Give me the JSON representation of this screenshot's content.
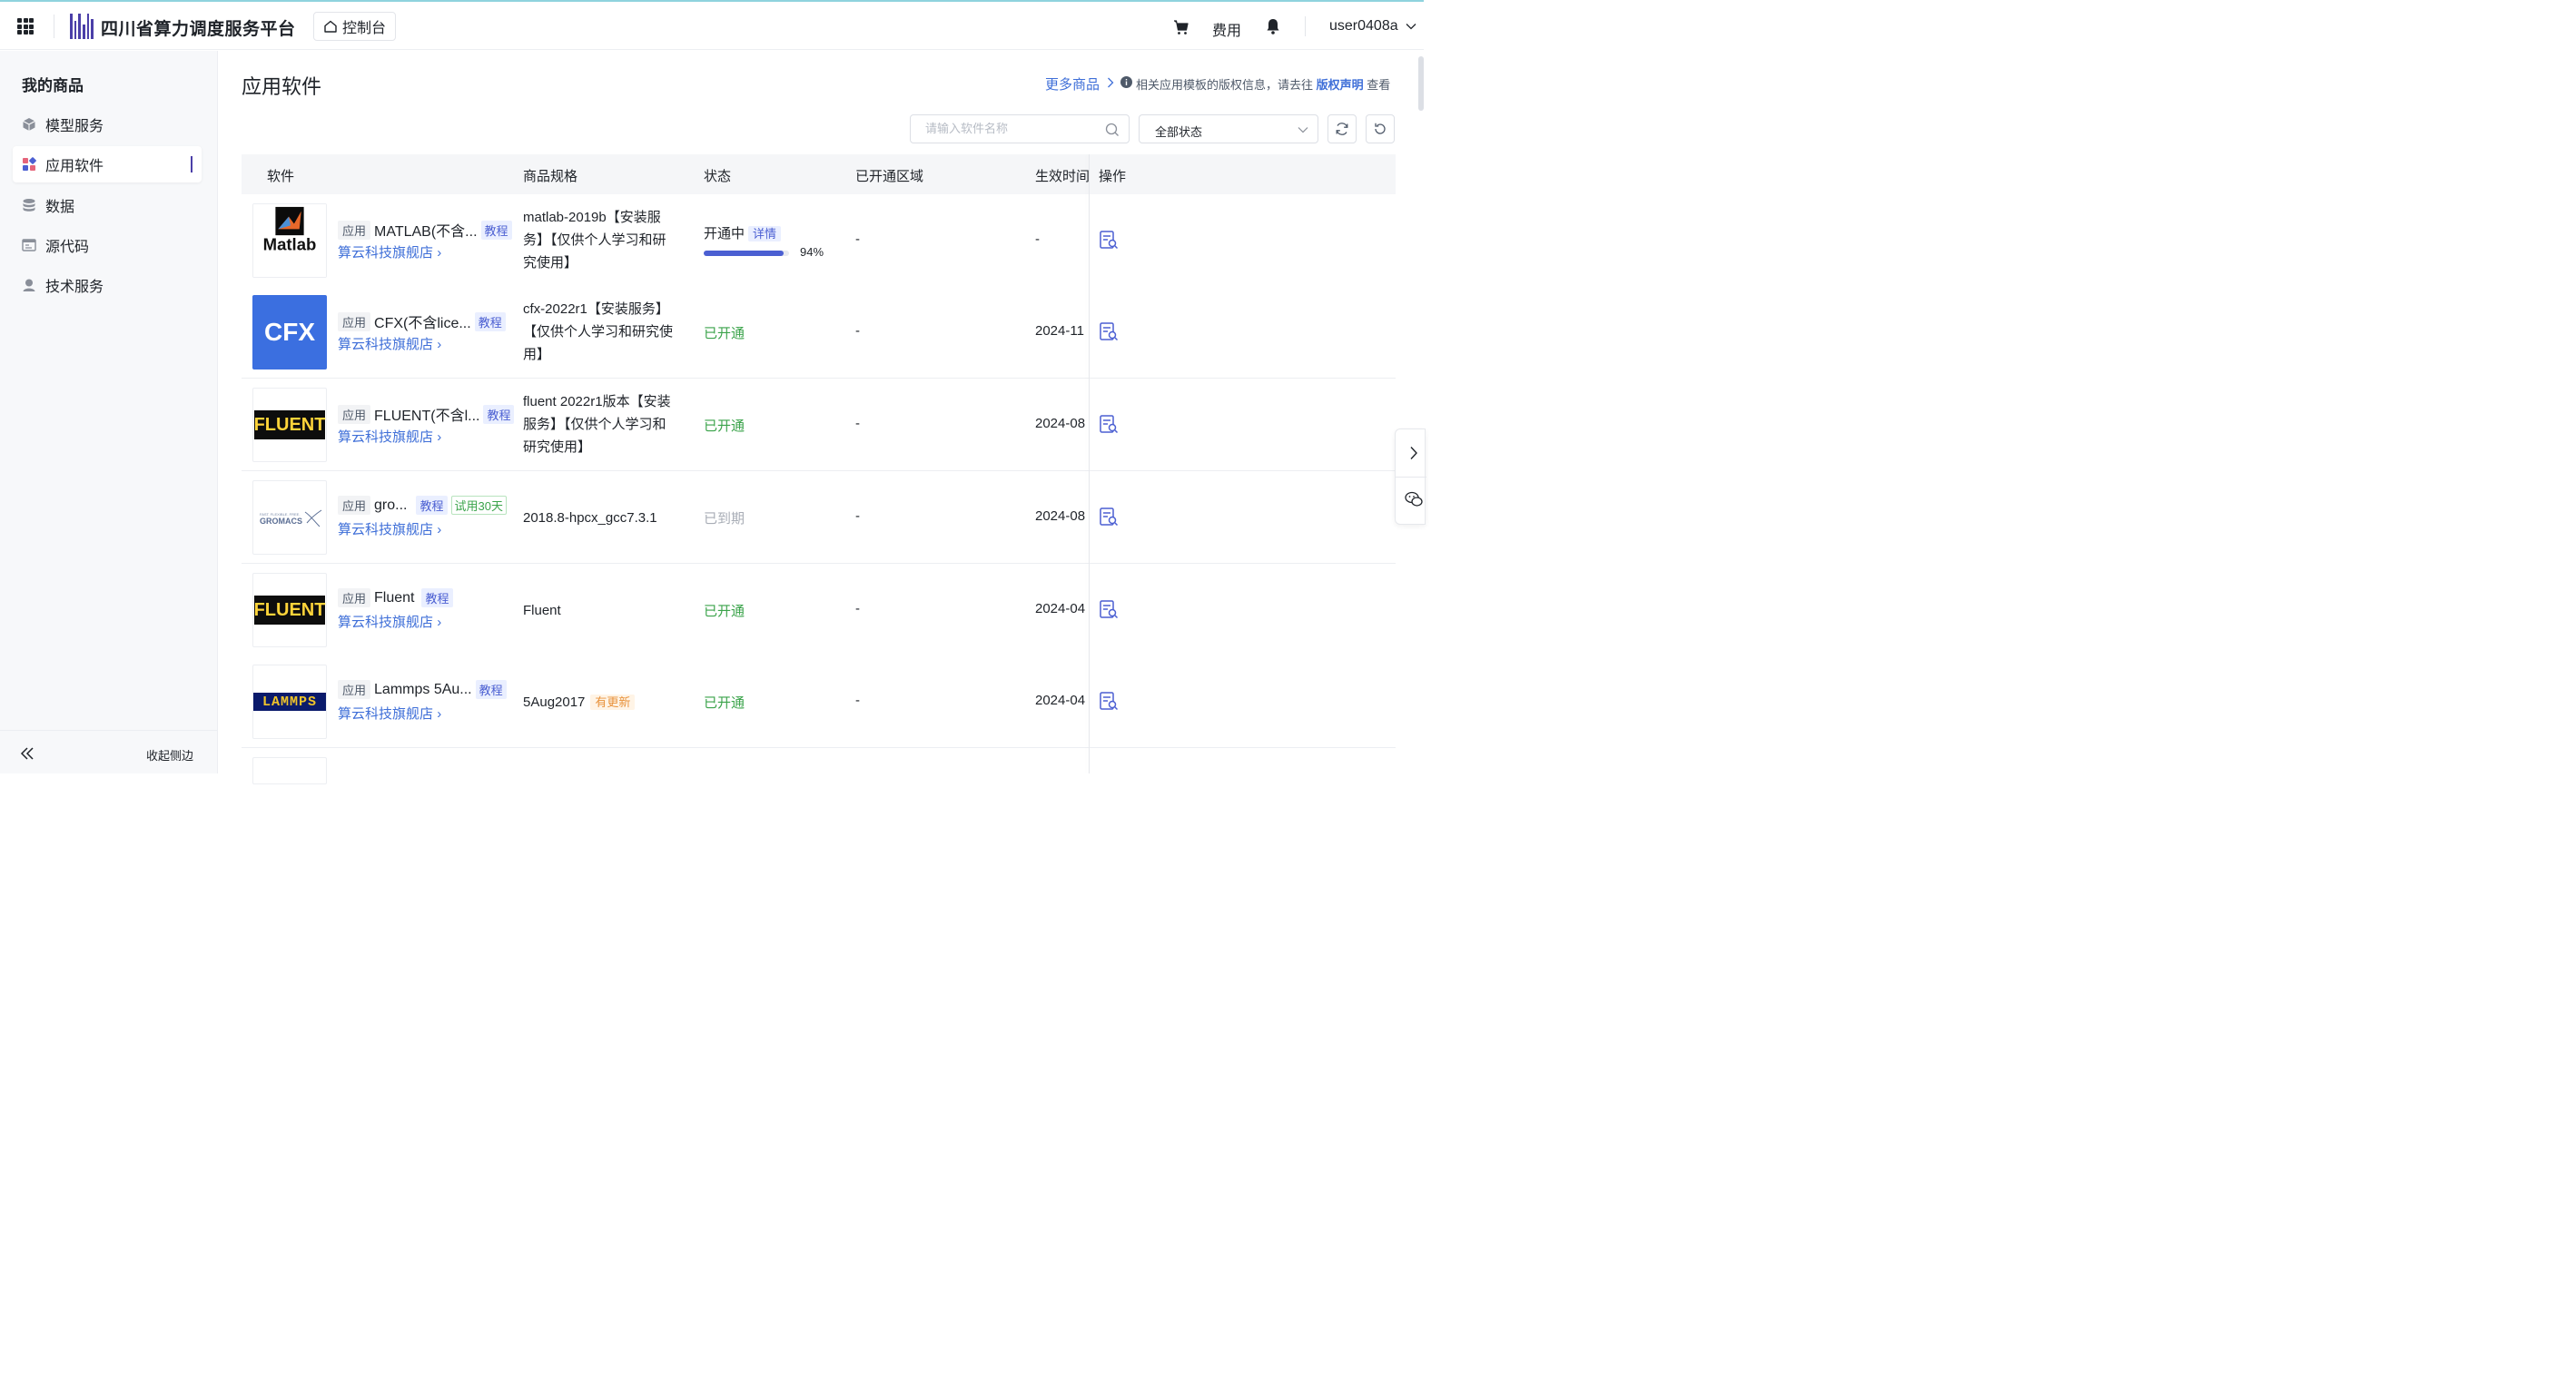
{
  "header": {
    "brand": "四川省算力调度服务平台",
    "console": "控制台",
    "fee": "费用",
    "user": "user0408a"
  },
  "sidebar": {
    "title": "我的商品",
    "items": [
      {
        "label": "模型服务"
      },
      {
        "label": "应用软件"
      },
      {
        "label": "数据"
      },
      {
        "label": "源代码"
      },
      {
        "label": "技术服务"
      }
    ],
    "collapse": "收起侧边"
  },
  "main": {
    "title": "应用软件",
    "more": "更多商品",
    "copyright_prefix": "相关应用模板的版权信息，请去往",
    "copyright_link": "版权声明",
    "copyright_suffix": "查看",
    "search_placeholder": "请输入软件名称",
    "status_filter": "全部状态"
  },
  "table": {
    "columns": [
      "软件",
      "商品规格",
      "状态",
      "已开通区域",
      "生效时间",
      "操作"
    ],
    "rows": [
      {
        "tag": "应用",
        "name": "MATLAB(不含...",
        "tutorial": "教程",
        "store": "算云科技旗舰店",
        "spec_lines": [
          "matlab-2019b【安装服",
          "务】【仅供个人学习和研",
          "究使用】"
        ],
        "status": "开通中",
        "detail": "详情",
        "progress": 94,
        "progress_label": "94%",
        "region": "-",
        "effective": "-"
      },
      {
        "tag": "应用",
        "name": "CFX(不含lice...",
        "tutorial": "教程",
        "store": "算云科技旗舰店",
        "spec_lines": [
          "cfx-2022r1【安装服务】",
          "【仅供个人学习和研究使",
          "用】"
        ],
        "status": "已开通",
        "region": "-",
        "effective": "2024-11"
      },
      {
        "tag": "应用",
        "name": "FLUENT(不含l...",
        "tutorial": "教程",
        "store": "算云科技旗舰店",
        "spec_lines": [
          "fluent 2022r1版本【安装",
          "服务】【仅供个人学习和",
          "研究使用】"
        ],
        "status": "已开通",
        "region": "-",
        "effective": "2024-08"
      },
      {
        "tag": "应用",
        "name": "gro...",
        "tutorial": "教程",
        "trial": "试用30天",
        "store": "算云科技旗舰店",
        "spec_lines": [
          "2018.8-hpcx_gcc7.3.1"
        ],
        "status": "已到期",
        "region": "-",
        "effective": "2024-08"
      },
      {
        "tag": "应用",
        "name": "Fluent",
        "tutorial": "教程",
        "store": "算云科技旗舰店",
        "spec_lines": [
          "Fluent"
        ],
        "status": "已开通",
        "region": "-",
        "effective": "2024-04"
      },
      {
        "tag": "应用",
        "name": "Lammps 5Au...",
        "tutorial": "教程",
        "store": "算云科技旗舰店",
        "spec_lines": [
          "5Aug2017"
        ],
        "update": "有更新",
        "status": "已开通",
        "region": "-",
        "effective": "2024-04"
      }
    ]
  },
  "thumbs": {
    "matlab": "Matlab",
    "cfx": "CFX",
    "fluent": "FLUENT",
    "gromacs": "GROMACS",
    "gromacs_small": "FAST. FLEXIBLE. FREE.",
    "lammps": "LAMMPS"
  },
  "colors": {
    "primary": "#4b5fd2",
    "link": "#3f6fd8",
    "success": "#3aa34a",
    "expired": "#a8adb6",
    "warning": "#e8923b"
  }
}
